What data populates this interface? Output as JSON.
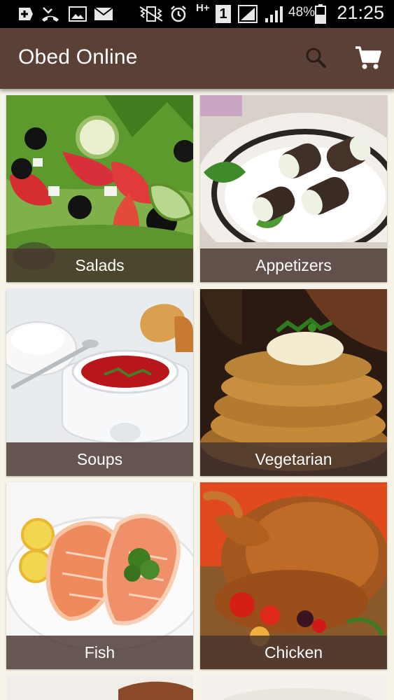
{
  "status_bar": {
    "battery_percent": "48%",
    "time": "21:25",
    "network_type": "H+",
    "sim_slot": "1",
    "icons": [
      "add-icon",
      "missed-call-icon",
      "image-icon",
      "mail-icon",
      "vibrate-icon",
      "alarm-icon",
      "signal-icon",
      "battery-icon"
    ]
  },
  "app_bar": {
    "title": "Obed Online",
    "icons": [
      "search-icon",
      "cart-icon"
    ]
  },
  "categories": [
    {
      "label": "Salads",
      "icon": "salad-image"
    },
    {
      "label": "Appetizers",
      "icon": "appetizers-image"
    },
    {
      "label": "Soups",
      "icon": "soup-image"
    },
    {
      "label": "Vegetarian",
      "icon": "vegetarian-image"
    },
    {
      "label": "Fish",
      "icon": "fish-image"
    },
    {
      "label": "Chicken",
      "icon": "chicken-image"
    }
  ],
  "colors": {
    "app_bar": "#5b4038",
    "caption_overlay": "#48342e",
    "background": "#f6f3e8"
  }
}
